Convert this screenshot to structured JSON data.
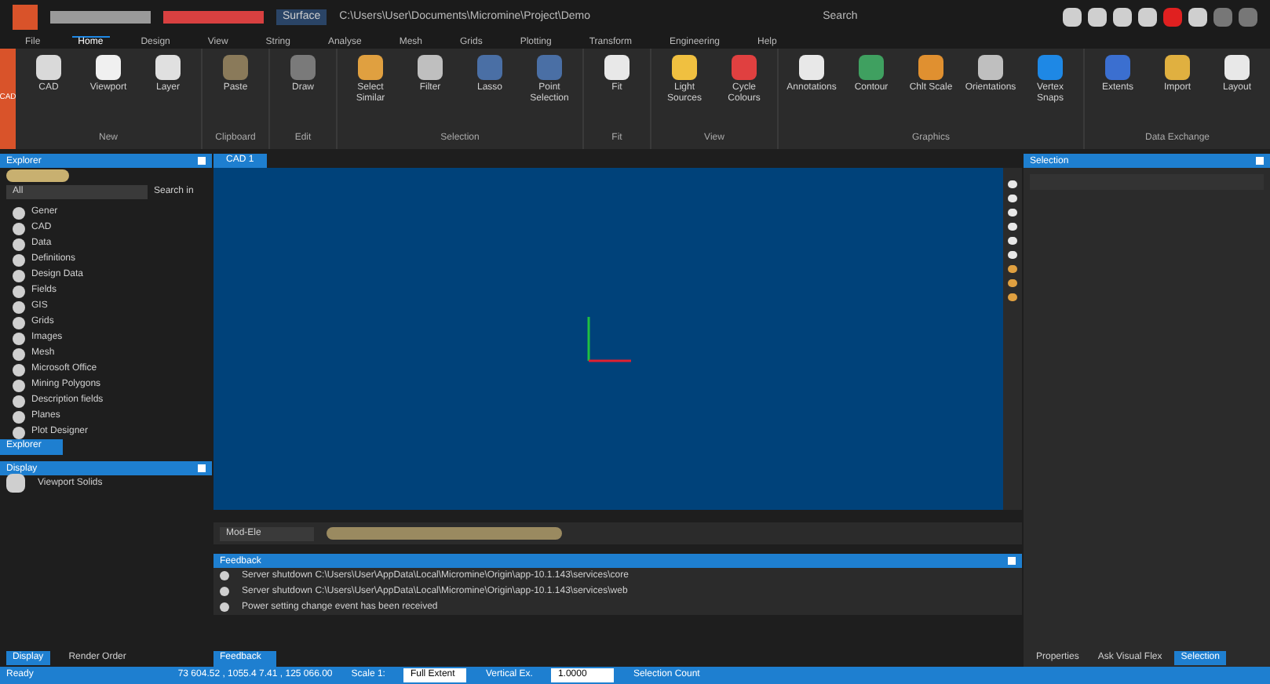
{
  "title_bar": {
    "layout": "Surface",
    "path": "C:\\Users\\User\\Documents\\Micromine\\Project\\Demo",
    "search": {
      "placeholder": "Search"
    }
  },
  "menu": [
    {
      "label": "File",
      "selected": false
    },
    {
      "label": "Home",
      "selected": true
    },
    {
      "label": "Design",
      "selected": false
    },
    {
      "label": "View",
      "selected": false
    },
    {
      "label": "String",
      "selected": false
    },
    {
      "label": "Analyse",
      "selected": false
    },
    {
      "label": "Mesh",
      "selected": false
    },
    {
      "label": "Grids",
      "selected": false
    },
    {
      "label": "Plotting",
      "selected": false
    },
    {
      "label": "Transform",
      "selected": false
    },
    {
      "label": "Engineering",
      "selected": false
    },
    {
      "label": "Help",
      "selected": false
    }
  ],
  "ribbon": {
    "side_tab": "CAD",
    "groups": [
      {
        "label": "New",
        "buttons": [
          {
            "label": "CAD",
            "color": "#d9d9d9"
          },
          {
            "label": "Viewport",
            "color": "#f0f0f0"
          },
          {
            "label": "Layer",
            "color": "#e0e0e0"
          }
        ]
      },
      {
        "label": "Clipboard",
        "buttons": [
          {
            "label": "Paste",
            "color": "#8a7a5a"
          }
        ]
      },
      {
        "label": "Edit",
        "buttons": [
          {
            "label": "Draw",
            "color": "#7a7a7a"
          }
        ]
      },
      {
        "label": "Selection",
        "buttons": [
          {
            "label": "Select Similar",
            "color": "#e0a040"
          },
          {
            "label": "Filter",
            "color": "#bfbfbf"
          },
          {
            "label": "Lasso",
            "color": "#4a6fa5"
          },
          {
            "label": "Point Selection",
            "color": "#4a6fa5"
          }
        ]
      },
      {
        "label": "Fit",
        "buttons": [
          {
            "label": "Fit",
            "color": "#e8e8e8"
          }
        ]
      },
      {
        "label": "View",
        "buttons": [
          {
            "label": "Light Sources",
            "color": "#f0c040"
          },
          {
            "label": "Cycle Colours",
            "color": "#e04040"
          }
        ]
      },
      {
        "label": "Graphics",
        "buttons": [
          {
            "label": "Annotations",
            "color": "#e8e8e8"
          },
          {
            "label": "Contour",
            "color": "#3fa060"
          },
          {
            "label": "Chlt Scale",
            "color": "#e09030"
          },
          {
            "label": "Orientations",
            "color": "#bfbfbf"
          },
          {
            "label": "Vertex Snaps",
            "color": "#1e88e5"
          }
        ]
      },
      {
        "label": "Data Exchange",
        "buttons": [
          {
            "label": "Extents",
            "color": "#3b6fd0"
          },
          {
            "label": "Import",
            "color": "#e0b040"
          },
          {
            "label": "Layout",
            "color": "#e8e8e8"
          }
        ]
      }
    ]
  },
  "explorer": {
    "title": "Explorer",
    "filter": "All",
    "search_label": "Search in",
    "items": [
      {
        "label": "Gener"
      },
      {
        "label": "CAD"
      },
      {
        "label": "Data"
      },
      {
        "label": "Definitions"
      },
      {
        "label": "Design Data"
      },
      {
        "label": "Fields"
      },
      {
        "label": "GIS"
      },
      {
        "label": "Grids"
      },
      {
        "label": "Images"
      },
      {
        "label": "Mesh"
      },
      {
        "label": "Microsoft Office"
      },
      {
        "label": "Mining Polygons"
      },
      {
        "label": "Description fields"
      },
      {
        "label": "Planes"
      },
      {
        "label": "Plot Designer"
      }
    ],
    "tab": "Explorer"
  },
  "display": {
    "title": "Display",
    "row": "Viewport Solids",
    "tabs": [
      {
        "label": "Display",
        "selected": true
      },
      {
        "label": "Render Order",
        "selected": false
      }
    ]
  },
  "viewport": {
    "tab": "CAD 1",
    "view_mode": "Mod-Ele"
  },
  "feedback": {
    "title": "Feedback",
    "lines": [
      "Server shutdown C:\\Users\\User\\AppData\\Local\\Micromine\\Origin\\app-10.1.143\\services\\core",
      "Server shutdown C:\\Users\\User\\AppData\\Local\\Micromine\\Origin\\app-10.1.143\\services\\web",
      "Power setting change event has been received"
    ],
    "tab": "Feedback"
  },
  "right_panel": {
    "title": "Selection",
    "tabs": [
      {
        "label": "Properties",
        "selected": false
      },
      {
        "label": "Ask Visual Flex",
        "selected": false
      },
      {
        "label": "Selection",
        "selected": true
      }
    ]
  },
  "status_bar": {
    "state": "Ready",
    "coords": "73 604.52 , 1055.4 7.41 , 125 066.00",
    "scale_label": "Scale 1:",
    "scale": "Full Extent",
    "exag_label": "Vertical Ex.",
    "exag": "1.0000",
    "selection": "Selection Count"
  }
}
